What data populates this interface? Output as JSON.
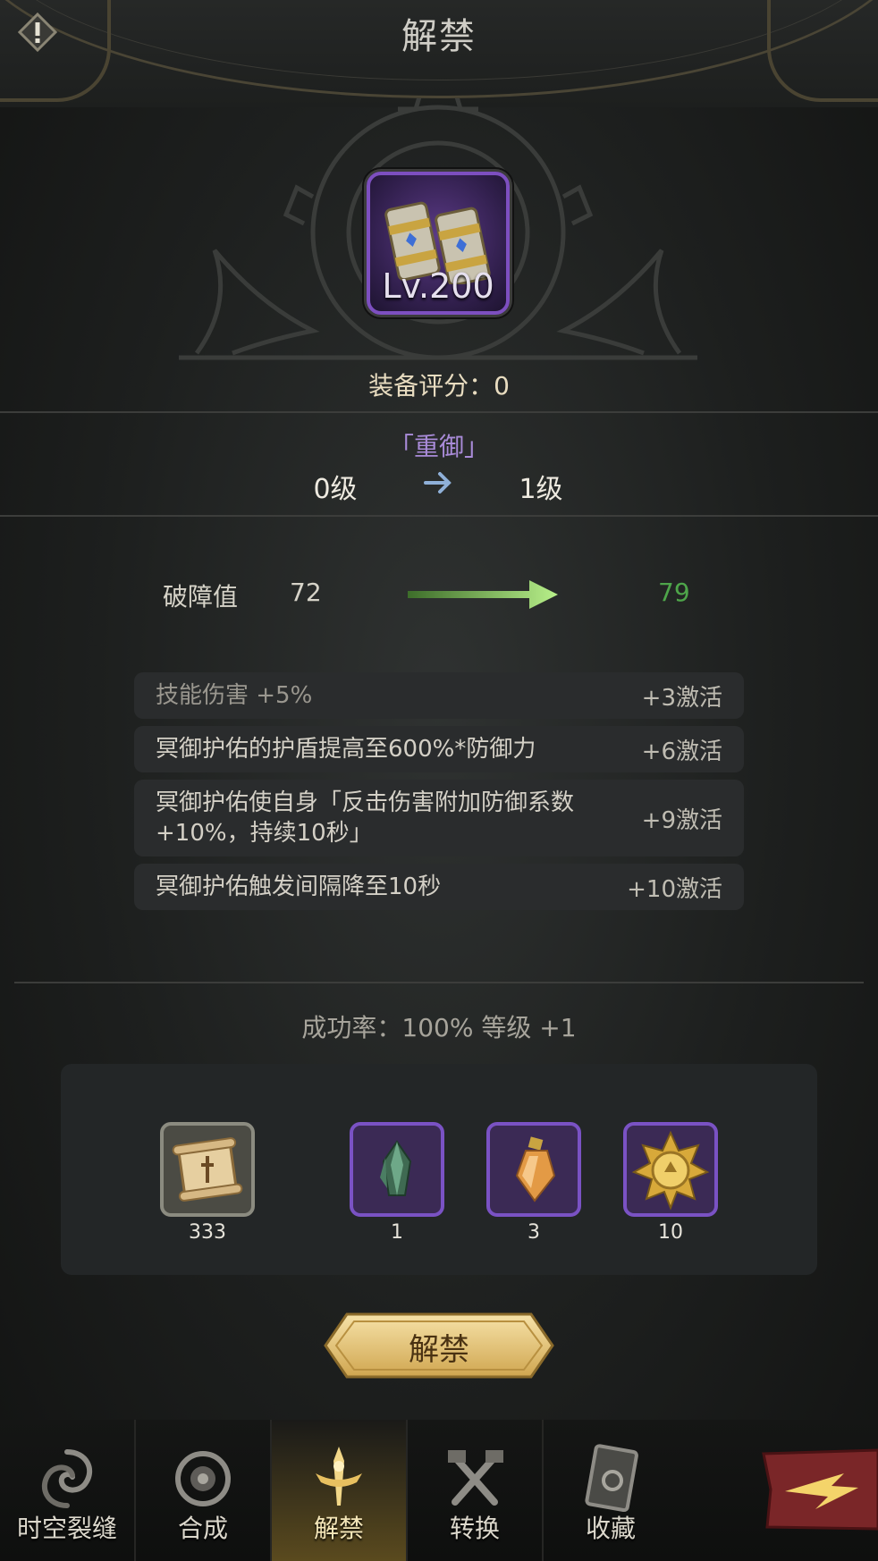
{
  "header": {
    "title": "解禁",
    "info_icon": "exclamation-icon"
  },
  "item": {
    "level_text": "Lv.200",
    "rarity_color": "#7d4fc0",
    "icon": "gauntlets-icon"
  },
  "score": {
    "text": "装备评分：0"
  },
  "skill": {
    "name": "「重御」",
    "level_from": "0级",
    "level_to": "1级"
  },
  "stat": {
    "label": "破障值",
    "old_value": "72",
    "new_value": "79",
    "new_value_color": "#4ea54a"
  },
  "bonuses": [
    {
      "text": "技能伤害 +5%",
      "activate": "+3激活"
    },
    {
      "text": "冥御护佑的护盾提高至600%*防御力",
      "activate": "+6激活"
    },
    {
      "text": "冥御护佑使自身「反击伤害附加防御系数+10%，持续10秒」",
      "activate": "+9激活"
    },
    {
      "text": "冥御护佑触发间隔降至10秒",
      "activate": "+10激活"
    }
  ],
  "success": {
    "text": "成功率：100% 等级 +1"
  },
  "materials": [
    {
      "icon": "scroll-icon",
      "count": "333"
    },
    {
      "icon": "crystal-icon",
      "count": "1"
    },
    {
      "icon": "potion-icon",
      "count": "3"
    },
    {
      "icon": "medal-icon",
      "count": "10"
    }
  ],
  "action": {
    "label": "解禁"
  },
  "nav": {
    "tabs": [
      {
        "label": "时空裂缝",
        "icon": "vortex-icon"
      },
      {
        "label": "合成",
        "icon": "orb-icon"
      },
      {
        "label": "解禁",
        "icon": "sword-icon"
      },
      {
        "label": "转换",
        "icon": "tools-icon"
      },
      {
        "label": "收藏",
        "icon": "card-icon"
      }
    ],
    "next_icon": "arrow-right-icon"
  }
}
